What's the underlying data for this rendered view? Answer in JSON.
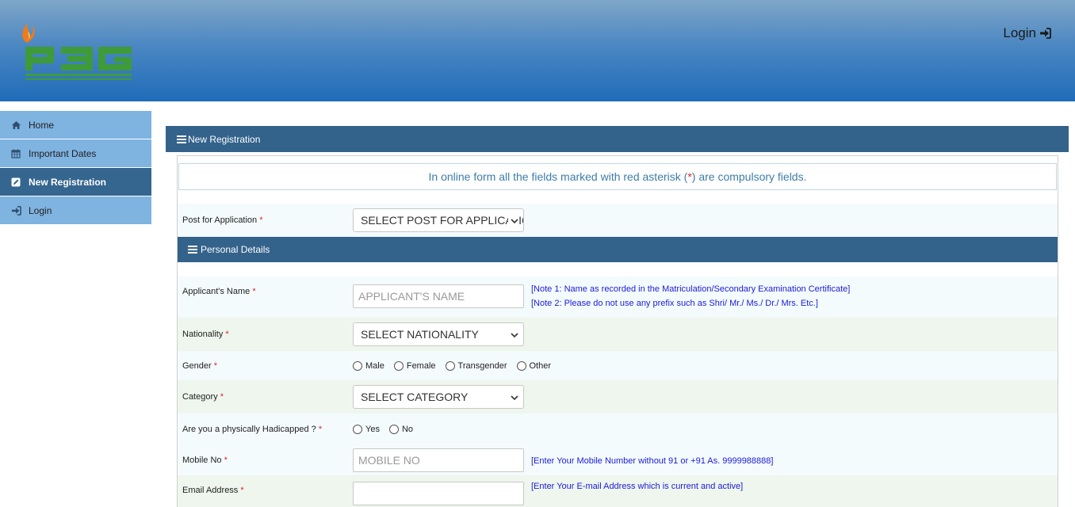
{
  "header": {
    "logo_text": "PBG",
    "login_label": "Login"
  },
  "sidebar": {
    "items": [
      {
        "label": "Home",
        "icon": "home-icon"
      },
      {
        "label": "Important Dates",
        "icon": "calendar-icon"
      },
      {
        "label": "New Registration",
        "icon": "edit-icon",
        "active": true
      },
      {
        "label": "Login",
        "icon": "sign-in-icon"
      }
    ]
  },
  "main": {
    "section_title": "New Registration",
    "notice_before": "In online form all the fields marked with red asterisk (",
    "notice_star": "*",
    "notice_after": ") are compulsory fields.",
    "post": {
      "label": "Post for Application",
      "value": "SELECT POST FOR APPLICATION"
    },
    "personal_title": "Personal Details",
    "name": {
      "label": "Applicant's Name",
      "placeholder": "APPLICANT'S NAME",
      "note1": "[Note 1: Name as recorded in the Matriculation/Secondary Examination Certificate]",
      "note2": "[Note 2: Please do not use any prefix such as Shri/ Mr./ Ms./ Dr./ Mrs. Etc.]"
    },
    "nationality": {
      "label": "Nationality",
      "value": "SELECT NATIONALITY"
    },
    "gender": {
      "label": "Gender",
      "options": [
        "Male",
        "Female",
        "Transgender",
        "Other"
      ]
    },
    "category": {
      "label": "Category",
      "value": "SELECT CATEGORY"
    },
    "handicapped": {
      "label": "Are you a physically Hadicapped ?",
      "options": [
        "Yes",
        "No"
      ]
    },
    "mobile": {
      "label": "Mobile No",
      "placeholder": "MOBILE NO",
      "note": "[Enter Your Mobile Number without 91 or +91 As. 9999988888]"
    },
    "email": {
      "label": "Email Address",
      "note": "[Enter Your E-mail Address which is current and active]"
    },
    "required_mark": "*"
  },
  "colors": {
    "header_top": "#7fa6c9",
    "header_bottom": "#1f6cb9",
    "sidebar_bg": "#7fb3e0",
    "sidebar_active": "#35668f",
    "section_bar": "#33628b",
    "required": "#d9262c",
    "note_text": "#1b1bd6"
  }
}
